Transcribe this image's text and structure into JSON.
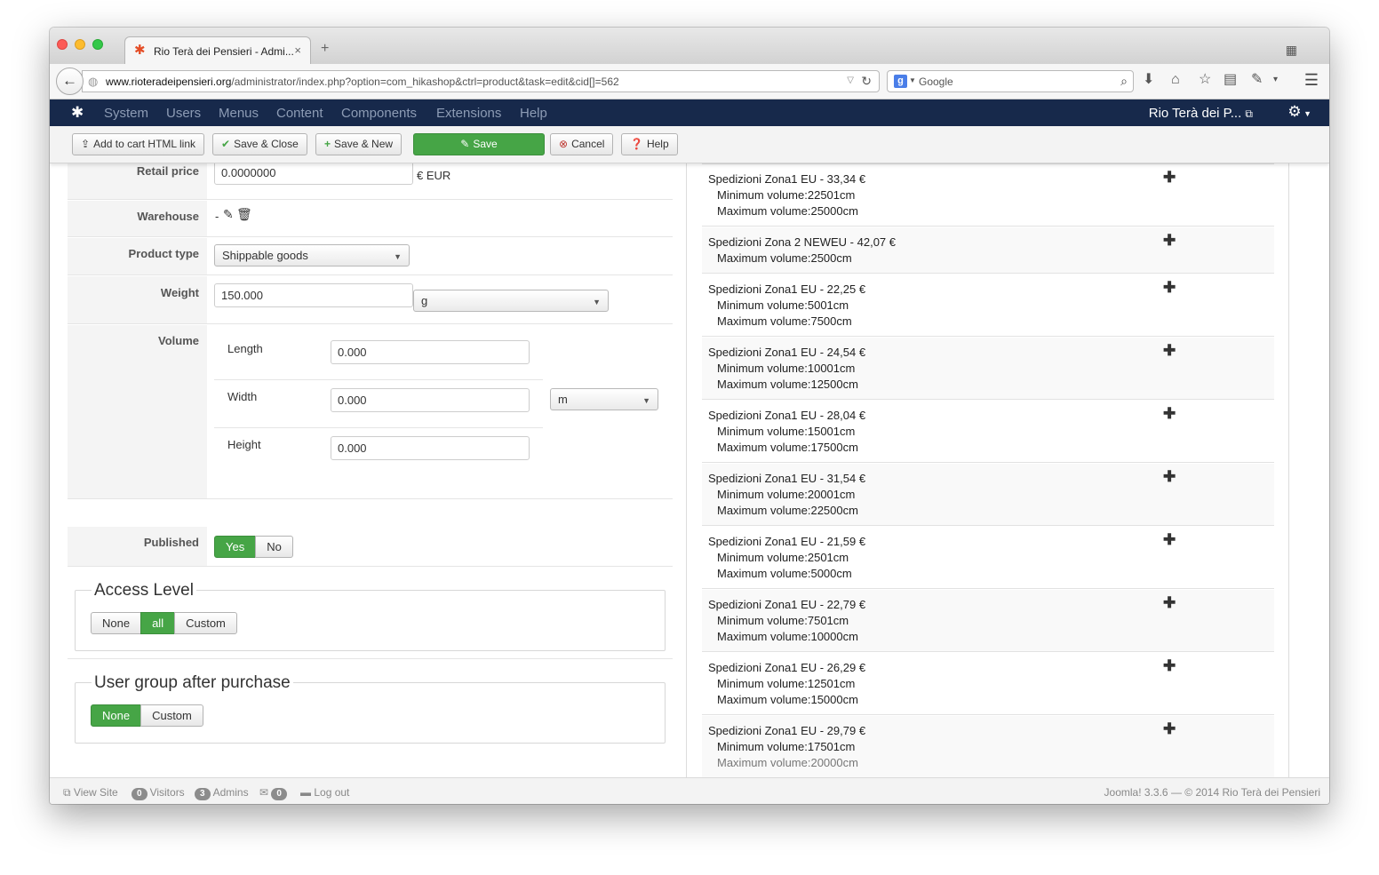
{
  "browser": {
    "tab_title": "Rio Terà dei Pensieri - Admi...",
    "url_host": "www.rioteradeipensieri.org",
    "url_path": "/administrator/index.php?option=com_hikashop&ctrl=product&task=edit&cid[]=562",
    "search_placeholder": "Google",
    "search_engine_letter": "g"
  },
  "joomla_nav": {
    "menus": [
      "System",
      "Users",
      "Menus",
      "Content",
      "Components",
      "Extensions",
      "Help"
    ],
    "site_name": "Rio Terà dei P..."
  },
  "toolbar": {
    "add_to_cart": "Add to cart HTML link",
    "save_close": "Save & Close",
    "save_new": "Save & New",
    "save": "Save",
    "cancel": "Cancel",
    "help": "Help"
  },
  "form": {
    "retail_price_label": "Retail price",
    "retail_price_value": "0.0000000",
    "currency": "€ EUR",
    "warehouse_label": "Warehouse",
    "warehouse_value": "-",
    "product_type_label": "Product type",
    "product_type_value": "Shippable goods",
    "weight_label": "Weight",
    "weight_value": "150.000",
    "weight_unit": "g",
    "volume_label": "Volume",
    "length_label": "Length",
    "length_value": "0.000",
    "width_label": "Width",
    "width_value": "0.000",
    "height_label": "Height",
    "height_value": "0.000",
    "dimension_unit": "m",
    "published_label": "Published",
    "published_yes": "Yes",
    "published_no": "No",
    "published_selected": "Yes"
  },
  "access_level": {
    "legend": "Access Level",
    "options": [
      "None",
      "all",
      "Custom"
    ],
    "selected": "all"
  },
  "user_group": {
    "legend": "User group after purchase",
    "options": [
      "None",
      "Custom"
    ],
    "selected": "None"
  },
  "shipping": [
    {
      "title": "Spedizioni Zona1 EU - 33,34 €",
      "lines": [
        "Minimum volume:22501cm",
        "Maximum volume:25000cm"
      ]
    },
    {
      "title": "Spedizioni Zona 2 NEWEU - 42,07 €",
      "lines": [
        "Maximum volume:2500cm"
      ]
    },
    {
      "title": "Spedizioni Zona1 EU - 22,25 €",
      "lines": [
        "Minimum volume:5001cm",
        "Maximum volume:7500cm"
      ]
    },
    {
      "title": "Spedizioni Zona1 EU - 24,54 €",
      "lines": [
        "Minimum volume:10001cm",
        "Maximum volume:12500cm"
      ]
    },
    {
      "title": "Spedizioni Zona1 EU - 28,04 €",
      "lines": [
        "Minimum volume:15001cm",
        "Maximum volume:17500cm"
      ]
    },
    {
      "title": "Spedizioni Zona1 EU - 31,54 €",
      "lines": [
        "Minimum volume:20001cm",
        "Maximum volume:22500cm"
      ]
    },
    {
      "title": "Spedizioni Zona1 EU - 21,59 €",
      "lines": [
        "Minimum volume:2501cm",
        "Maximum volume:5000cm"
      ]
    },
    {
      "title": "Spedizioni Zona1 EU - 22,79 €",
      "lines": [
        "Minimum volume:7501cm",
        "Maximum volume:10000cm"
      ]
    },
    {
      "title": "Spedizioni Zona1 EU - 26,29 €",
      "lines": [
        "Minimum volume:12501cm",
        "Maximum volume:15000cm"
      ]
    },
    {
      "title": "Spedizioni Zona1 EU - 29,79 €",
      "lines": [
        "Minimum volume:17501cm",
        "Maximum volume:20000cm"
      ]
    }
  ],
  "status_bar": {
    "view_site": "View Site",
    "visitors_count": "0",
    "visitors_label": "Visitors",
    "admins_count": "3",
    "admins_label": "Admins",
    "messages_count": "0",
    "logout": "Log out",
    "version": "Joomla! 3.3.6",
    "separator": "—",
    "copyright": "© 2014 Rio Terà dei Pensieri"
  },
  "colors": {
    "joomla_nav_bg": "#17294b",
    "success_green": "#46a546",
    "cancel_red": "#bd362f"
  }
}
